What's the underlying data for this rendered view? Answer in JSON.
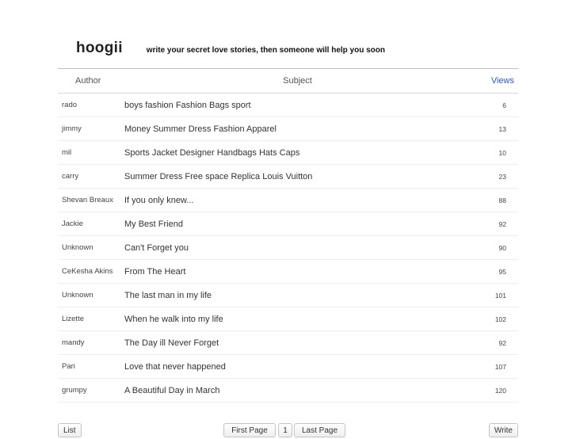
{
  "header": {
    "brand": "hoogii",
    "tagline": "write your secret love stories, then someone will help you soon"
  },
  "table": {
    "columns": {
      "author": "Author",
      "subject": "Subject",
      "views": "Views"
    },
    "rows": [
      {
        "author": "rado",
        "subject": "boys fashion Fashion Bags sport",
        "views": "6"
      },
      {
        "author": "jimmy",
        "subject": "Money Summer Dress Fashion Apparel",
        "views": "13"
      },
      {
        "author": "mil",
        "subject": "Sports Jacket Designer Handbags Hats Caps",
        "views": "10"
      },
      {
        "author": "carry",
        "subject": "Summer Dress Free space Replica Louis Vuitton",
        "views": "23"
      },
      {
        "author": "Shevan Breaux",
        "subject": "If you only knew...",
        "views": "88"
      },
      {
        "author": "Jackie",
        "subject": "My Best Friend",
        "views": "92"
      },
      {
        "author": "Unknown",
        "subject": "Can't Forget you",
        "views": "90"
      },
      {
        "author": "CeKesha Akins",
        "subject": "From The Heart",
        "views": "95"
      },
      {
        "author": "Unknown",
        "subject": "The last man in my life",
        "views": "101"
      },
      {
        "author": "Lizette",
        "subject": "When he walk into my life",
        "views": "102"
      },
      {
        "author": "mandy",
        "subject": "The Day ill Never Forget",
        "views": "92"
      },
      {
        "author": "Pari",
        "subject": "Love that never happened",
        "views": "107"
      },
      {
        "author": "grumpy",
        "subject": "A Beautiful Day in March",
        "views": "120"
      }
    ]
  },
  "footer": {
    "list_label": "List",
    "write_label": "Write",
    "first_page_label": "First Page",
    "current_page": "1",
    "last_page_label": "Last Page"
  }
}
